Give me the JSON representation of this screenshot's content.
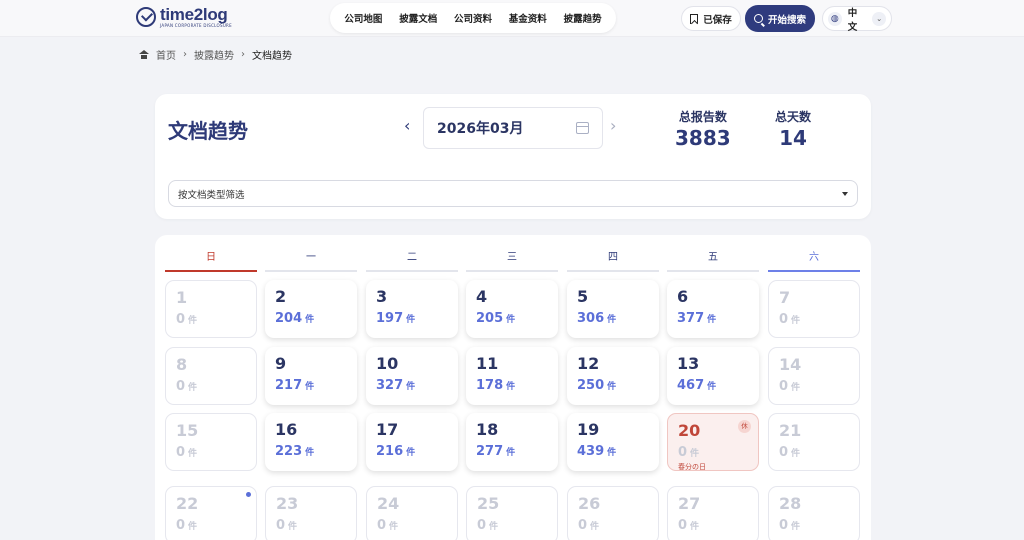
{
  "brand": {
    "name": "time2log",
    "tagline": "JAPAN CORPORATE DISCLOSURE"
  },
  "nav": [
    "公司地图",
    "披露文档",
    "公司资料",
    "基金资料",
    "披露趋势"
  ],
  "header": {
    "saved_label": "已保存",
    "search_label": "开始搜索",
    "language": "中文"
  },
  "breadcrumb": {
    "home": "首页",
    "parent": "披露趋势",
    "current": "文档趋势"
  },
  "page": {
    "title": "文档趋势",
    "month": "2026年03月",
    "stats": {
      "total_reports_label": "总报告数",
      "total_reports": "3883",
      "total_days_label": "总天数",
      "total_days": "14"
    },
    "filter_placeholder": "按文档类型筛选"
  },
  "calendar": {
    "weekdays": [
      "日",
      "一",
      "二",
      "三",
      "四",
      "五",
      "六"
    ],
    "unit": "件",
    "weeks": [
      [
        {
          "day": "1",
          "count": "0",
          "active": false
        },
        {
          "day": "2",
          "count": "204",
          "active": true
        },
        {
          "day": "3",
          "count": "197",
          "active": true
        },
        {
          "day": "4",
          "count": "205",
          "active": true
        },
        {
          "day": "5",
          "count": "306",
          "active": true
        },
        {
          "day": "6",
          "count": "377",
          "active": true
        },
        {
          "day": "7",
          "count": "0",
          "active": false
        }
      ],
      [
        {
          "day": "8",
          "count": "0",
          "active": false
        },
        {
          "day": "9",
          "count": "217",
          "active": true
        },
        {
          "day": "10",
          "count": "327",
          "active": true
        },
        {
          "day": "11",
          "count": "178",
          "active": true
        },
        {
          "day": "12",
          "count": "250",
          "active": true
        },
        {
          "day": "13",
          "count": "467",
          "active": true
        },
        {
          "day": "14",
          "count": "0",
          "active": false
        }
      ],
      [
        {
          "day": "15",
          "count": "0",
          "active": false
        },
        {
          "day": "16",
          "count": "223",
          "active": true
        },
        {
          "day": "17",
          "count": "216",
          "active": true
        },
        {
          "day": "18",
          "count": "277",
          "active": true
        },
        {
          "day": "19",
          "count": "439",
          "active": true
        },
        {
          "day": "20",
          "count": "0",
          "active": false,
          "holiday": "春分の日",
          "badge": "休"
        },
        {
          "day": "21",
          "count": "0",
          "active": false
        }
      ],
      [
        {
          "day": "22",
          "count": "0",
          "active": false,
          "dot": true
        },
        {
          "day": "23",
          "count": "0",
          "active": false
        },
        {
          "day": "24",
          "count": "0",
          "active": false
        },
        {
          "day": "25",
          "count": "0",
          "active": false
        },
        {
          "day": "26",
          "count": "0",
          "active": false
        },
        {
          "day": "27",
          "count": "0",
          "active": false
        },
        {
          "day": "28",
          "count": "0",
          "active": false
        }
      ]
    ]
  }
}
